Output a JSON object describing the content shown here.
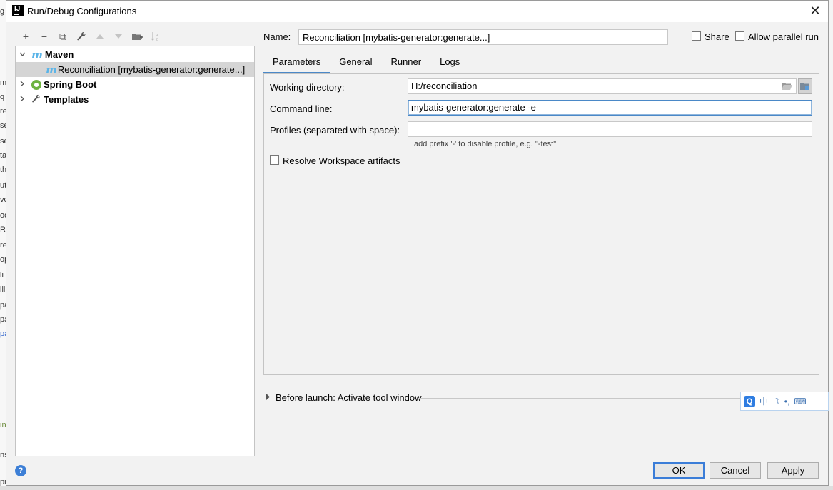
{
  "ide_background": {
    "left_fragments": [
      "g",
      "m",
      "q",
      "re",
      "se",
      "se",
      "ta",
      "th",
      "ut",
      "vo",
      "oo",
      "Re",
      "re",
      "op",
      "li",
      "lli",
      "pa",
      "pa",
      "pa",
      "in",
      "ns",
      "ping"
    ]
  },
  "dialog": {
    "title": "Run/Debug Configurations",
    "close_glyph": "✕"
  },
  "toolbar": {
    "add": "+",
    "remove": "−",
    "copy": "⧉",
    "edit": "🔧",
    "move_up": "▲",
    "move_down": "▼",
    "folder": "📁",
    "sort": "↓a"
  },
  "tree": {
    "maven": "Maven",
    "maven_child": "Reconciliation [mybatis-generator:generate...]",
    "spring_boot": "Spring Boot",
    "templates": "Templates"
  },
  "name_row": {
    "label": "Name:",
    "value": "Reconciliation [mybatis-generator:generate...]",
    "share": "Share",
    "allow_parallel": "Allow parallel run"
  },
  "tabs": [
    "Parameters",
    "General",
    "Runner",
    "Logs"
  ],
  "parameters": {
    "working_directory_label": "Working directory:",
    "working_directory_value": "H:/reconciliation",
    "command_line_label": "Command line:",
    "command_line_value": "mybatis-generator:generate -e",
    "profiles_label": "Profiles (separated with space):",
    "profiles_value": "",
    "profiles_hint": "add prefix '-' to disable profile, e.g. \"-test\"",
    "resolve_workspace": "Resolve Workspace artifacts"
  },
  "before_launch": "Before launch: Activate tool window",
  "ime": {
    "q": "Q",
    "lang": "中",
    "moon": "☽",
    "punct": "•,",
    "keyboard": "⌨"
  },
  "buttons": {
    "help": "?",
    "ok": "OK",
    "cancel": "Cancel",
    "apply": "Apply"
  }
}
